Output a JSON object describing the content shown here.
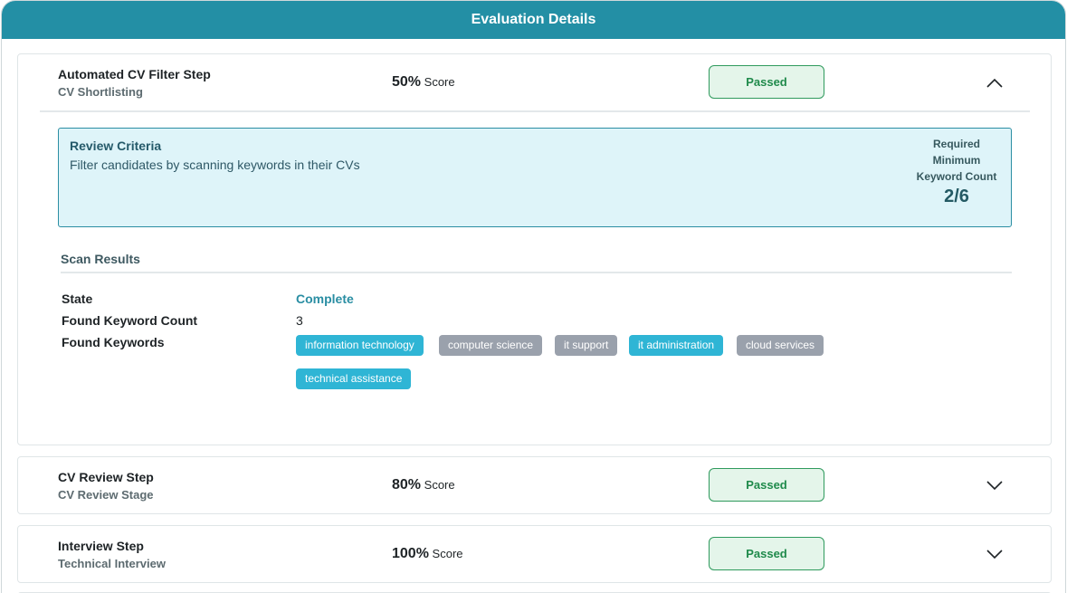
{
  "header": {
    "title": "Evaluation Details"
  },
  "steps": [
    {
      "title": "Automated CV Filter Step",
      "subtitle": "CV Shortlisting",
      "score_value": "50%",
      "score_label": "Score",
      "status": "Passed",
      "expanded": true
    },
    {
      "title": "CV Review Step",
      "subtitle": "CV Review Stage",
      "score_value": "80%",
      "score_label": "Score",
      "status": "Passed",
      "expanded": false
    },
    {
      "title": "Interview Step",
      "subtitle": "Technical Interview",
      "score_value": "100%",
      "score_label": "Score",
      "status": "Passed",
      "expanded": false
    }
  ],
  "criteria": {
    "title": "Review Criteria",
    "description": "Filter candidates by scanning keywords in their CVs",
    "required_line1": "Required",
    "required_line2": "Minimum",
    "required_line3": "Keyword Count",
    "required_value": "2/6"
  },
  "scan": {
    "title": "Scan Results",
    "state_label": "State",
    "state_value": "Complete",
    "count_label": "Found Keyword Count",
    "count_value": "3",
    "keywords_label": "Found Keywords",
    "keywords": [
      {
        "text": "information technology",
        "found": true
      },
      {
        "text": "computer science",
        "found": false
      },
      {
        "text": "it support",
        "found": false
      },
      {
        "text": "it administration",
        "found": true
      },
      {
        "text": "cloud services",
        "found": false
      },
      {
        "text": "technical assistance",
        "found": true
      }
    ]
  },
  "colors": {
    "header": "#238fa5",
    "badge_border": "#2f9a5d",
    "badge_bg": "#e4f5ea",
    "keyword_found": "#2fb5d5",
    "keyword_missing": "#9aa1ac",
    "criteria_bg": "#def4f9"
  },
  "icons": {
    "collapse": "chevron-up-icon",
    "expand": "chevron-down-icon"
  }
}
